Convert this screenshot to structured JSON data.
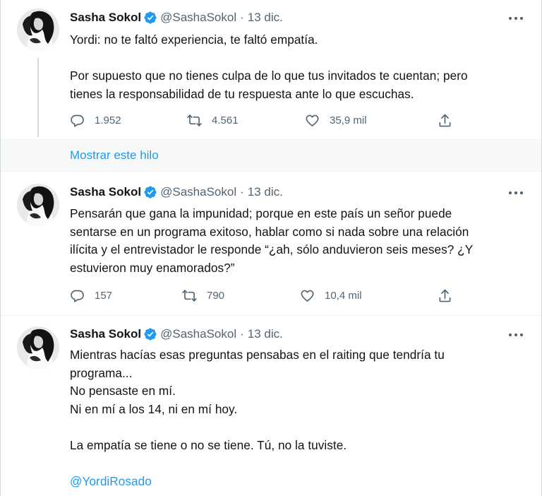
{
  "colors": {
    "accent": "#1d9bf0",
    "secondary_text": "#536471",
    "primary_text": "#0f1419"
  },
  "tweets": [
    {
      "name": "Sasha Sokol",
      "handle": "@SashaSokol",
      "separator": "·",
      "date": "13 dic.",
      "lines": [
        "Yordi: no te faltó experiencia, te faltó empatía.",
        "",
        "Por supuesto que no tienes culpa de lo que tus invitados te cuentan; pero",
        "tienes la responsabilidad de tu respuesta ante lo que escuchas."
      ],
      "replies": "1.952",
      "retweets": "4.561",
      "likes": "35,9 mil"
    },
    {
      "name": "Sasha Sokol",
      "handle": "@SashaSokol",
      "separator": "·",
      "date": "13 dic.",
      "lines": [
        "Pensarán que gana la impunidad; porque en este país un señor puede",
        "sentarse en un programa exitoso, hablar como si nada sobre una relación",
        "ilícita y el entrevistador le responde “¿ah, sólo anduvieron seis meses? ¿Y",
        "estuvieron muy enamorados?”"
      ],
      "replies": "157",
      "retweets": "790",
      "likes": "10,4 mil"
    },
    {
      "name": "Sasha Sokol",
      "handle": "@SashaSokol",
      "separator": "·",
      "date": "13 dic.",
      "lines": [
        "Mientras hacías esas preguntas pensabas en el raiting que tendría tu",
        "programa...",
        "No pensaste en mí.",
        "Ni en mí a los 14, ni en mí hoy.",
        "",
        "La empatía se tiene o no se tiene. Tú, no la tuviste.",
        ""
      ],
      "mention": "@YordiRosado"
    }
  ],
  "show_thread_label": "Mostrar este hilo",
  "icons": {
    "verified": "verified-badge-icon",
    "more": "more-horizontal-icon",
    "reply": "reply-bubble-icon",
    "retweet": "retweet-arrows-icon",
    "like": "heart-icon",
    "share": "share-upload-icon"
  }
}
